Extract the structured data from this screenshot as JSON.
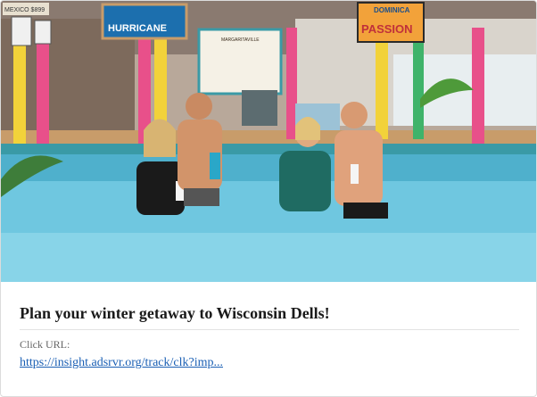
{
  "ad": {
    "headline": "Plan your winter getaway to Wisconsin Dells!",
    "click_url_label": "Click URL:",
    "click_url": "https://insight.adsrvr.org/track/clk?imp..."
  },
  "photo_signs": {
    "left_sign": "HURRICANE",
    "right_sign_top": "DOMINICA",
    "right_sign_main": "PASSION",
    "center_sign": "MARGARITAVILLE",
    "small_sign": "MEXICO $899"
  },
  "colors": {
    "link": "#1a5fb4",
    "pool_water": "#6fc7e0",
    "pillar_pink": "#e8508a",
    "pillar_yellow": "#f2d23a"
  }
}
